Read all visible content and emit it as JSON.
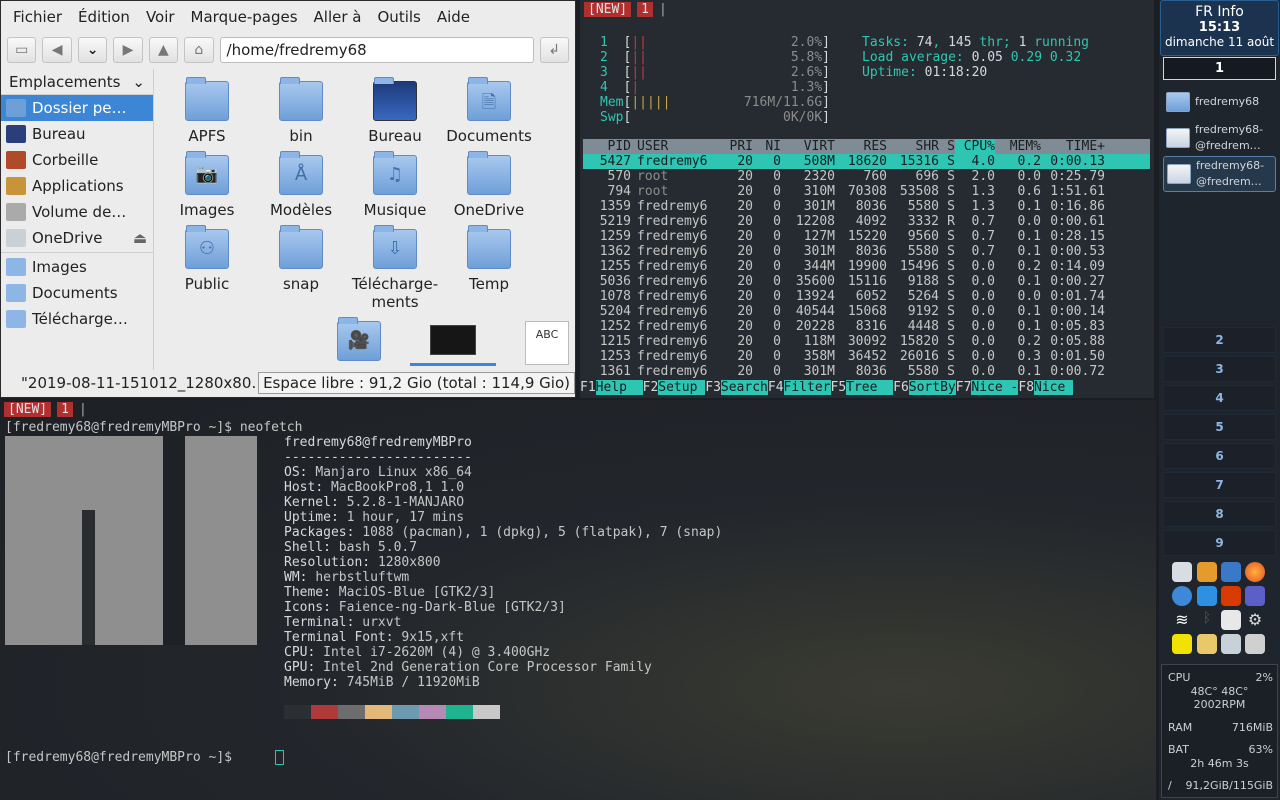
{
  "file_manager": {
    "menu": [
      "Fichier",
      "Édition",
      "Voir",
      "Marque-pages",
      "Aller à",
      "Outils",
      "Aide"
    ],
    "path": "/home/fredremy68",
    "sidebar_title": "Emplacements",
    "places": [
      "Dossier pe…",
      "Bureau",
      "Corbeille",
      "Applications",
      "Volume de…",
      "OneDrive"
    ],
    "bookmarks": [
      "Images",
      "Documents",
      "Télécharge…"
    ],
    "items": [
      {
        "label": "APFS",
        "glyph": ""
      },
      {
        "label": "bin",
        "glyph": ""
      },
      {
        "label": "Bureau",
        "glyph": ""
      },
      {
        "label": "Documents",
        "glyph": "🗎"
      },
      {
        "label": "Images",
        "glyph": "📷"
      },
      {
        "label": "Modèles",
        "glyph": "Å"
      },
      {
        "label": "Musique",
        "glyph": "♫"
      },
      {
        "label": "OneDrive",
        "glyph": ""
      },
      {
        "label": "Public",
        "glyph": "⚇"
      },
      {
        "label": "snap",
        "glyph": ""
      },
      {
        "label": "Télécharge-ments",
        "glyph": "⇩"
      },
      {
        "label": "Temp",
        "glyph": ""
      }
    ],
    "abc_label": "ABC",
    "status_file": "\"2019-08-11-151012_1280x80…",
    "status_free": "Espace libre : 91,2 Gio (total : 114,9 Gio)"
  },
  "htop": {
    "tab_new": "[NEW]",
    "tab_num": "1",
    "cpus": [
      {
        "id": "1",
        "pct": "2.0%"
      },
      {
        "id": "2",
        "pct": "5.8%"
      },
      {
        "id": "3",
        "pct": "2.6%"
      },
      {
        "id": "4",
        "pct": "1.3%"
      }
    ],
    "mem": "716M/11.6G",
    "swp": "0K/0K",
    "tasks": "74",
    "threads": "145",
    "running": "1",
    "load": [
      "0.05",
      "0.29",
      "0.32"
    ],
    "uptime": "01:18:20",
    "columns": [
      "PID",
      "USER",
      "PRI",
      "NI",
      "VIRT",
      "RES",
      "SHR",
      "S",
      "CPU%",
      "MEM%",
      "TIME+"
    ],
    "processes": [
      [
        "5427",
        "fredremy6",
        "20",
        "0",
        "508M",
        "18620",
        "15316",
        "S",
        "4.0",
        "0.2",
        "0:00.13"
      ],
      [
        "570",
        "root",
        "20",
        "0",
        "2320",
        "760",
        "696",
        "S",
        "2.0",
        "0.0",
        "0:25.79"
      ],
      [
        "794",
        "root",
        "20",
        "0",
        "310M",
        "70308",
        "53508",
        "S",
        "1.3",
        "0.6",
        "1:51.61"
      ],
      [
        "1359",
        "fredremy6",
        "20",
        "0",
        "301M",
        "8036",
        "5580",
        "S",
        "1.3",
        "0.1",
        "0:16.86"
      ],
      [
        "5219",
        "fredremy6",
        "20",
        "0",
        "12208",
        "4092",
        "3332",
        "R",
        "0.7",
        "0.0",
        "0:00.61"
      ],
      [
        "1259",
        "fredremy6",
        "20",
        "0",
        "127M",
        "15220",
        "9560",
        "S",
        "0.7",
        "0.1",
        "0:28.15"
      ],
      [
        "1362",
        "fredremy6",
        "20",
        "0",
        "301M",
        "8036",
        "5580",
        "S",
        "0.7",
        "0.1",
        "0:00.53"
      ],
      [
        "1255",
        "fredremy6",
        "20",
        "0",
        "344M",
        "19900",
        "15496",
        "S",
        "0.0",
        "0.2",
        "0:14.09"
      ],
      [
        "5036",
        "fredremy6",
        "20",
        "0",
        "35600",
        "15116",
        "9188",
        "S",
        "0.0",
        "0.1",
        "0:00.27"
      ],
      [
        "1078",
        "fredremy6",
        "20",
        "0",
        "13924",
        "6052",
        "5264",
        "S",
        "0.0",
        "0.0",
        "0:01.74"
      ],
      [
        "5204",
        "fredremy6",
        "20",
        "0",
        "40544",
        "15068",
        "9192",
        "S",
        "0.0",
        "0.1",
        "0:00.14"
      ],
      [
        "1252",
        "fredremy6",
        "20",
        "0",
        "20228",
        "8316",
        "4448",
        "S",
        "0.0",
        "0.1",
        "0:05.83"
      ],
      [
        "1215",
        "fredremy6",
        "20",
        "0",
        "118M",
        "30092",
        "15820",
        "S",
        "0.0",
        "0.2",
        "0:05.88"
      ],
      [
        "1253",
        "fredremy6",
        "20",
        "0",
        "358M",
        "36452",
        "26016",
        "S",
        "0.0",
        "0.3",
        "0:01.50"
      ],
      [
        "1361",
        "fredremy6",
        "20",
        "0",
        "301M",
        "8036",
        "5580",
        "S",
        "0.0",
        "0.1",
        "0:00.72"
      ]
    ],
    "footer": [
      {
        "key": "F1",
        "label": "Help  "
      },
      {
        "key": "F2",
        "label": "Setup "
      },
      {
        "key": "F3",
        "label": "Search"
      },
      {
        "key": "F4",
        "label": "Filter"
      },
      {
        "key": "F5",
        "label": "Tree  "
      },
      {
        "key": "F6",
        "label": "SortBy"
      },
      {
        "key": "F7",
        "label": "Nice -"
      },
      {
        "key": "F8",
        "label": "Nice "
      }
    ]
  },
  "terminal": {
    "tab_new": "[NEW]",
    "tab_num": "1",
    "prompt": "[fredremy68@fredremyMBPro ~]$ ",
    "command": "neofetch",
    "user_host": "fredremy68@fredremyMBPro",
    "separator": "------------------------",
    "info": [
      {
        "key": "OS",
        "value": "Manjaro Linux x86_64"
      },
      {
        "key": "Host",
        "value": "MacBookPro8,1 1.0"
      },
      {
        "key": "Kernel",
        "value": "5.2.8-1-MANJARO"
      },
      {
        "key": "Uptime",
        "value": "1 hour, 17 mins"
      },
      {
        "key": "Packages",
        "value": "1088 (pacman), 1 (dpkg), 5 (flatpak), 7 (snap)"
      },
      {
        "key": "Shell",
        "value": "bash 5.0.7"
      },
      {
        "key": "Resolution",
        "value": "1280x800"
      },
      {
        "key": "WM",
        "value": "herbstluftwm"
      },
      {
        "key": "Theme",
        "value": "MaciOS-Blue [GTK2/3]"
      },
      {
        "key": "Icons",
        "value": "Faience-ng-Dark-Blue [GTK2/3]"
      },
      {
        "key": "Terminal",
        "value": "urxvt"
      },
      {
        "key": "Terminal Font",
        "value": "9x15,xft"
      },
      {
        "key": "CPU",
        "value": "Intel i7-2620M (4) @ 3.400GHz"
      },
      {
        "key": "GPU",
        "value": "Intel 2nd Generation Core Processor Family"
      },
      {
        "key": "Memory",
        "value": "745MiB / 11920MiB"
      }
    ],
    "palette": [
      "#2b2f33",
      "#b03a3a",
      "#6d6d6d",
      "#e4b77a",
      "#6e9ab0",
      "#b589b3",
      "#1fb38f",
      "#c8c8c8"
    ]
  },
  "panel": {
    "title": "FR Info",
    "time": "15:13",
    "date": "dimanche 11 août",
    "active_workspace": "1",
    "windows": [
      {
        "label": "fredremy68"
      },
      {
        "label": "fredremy68-@fredrem…"
      },
      {
        "label": "fredremy68-@fredrem…"
      }
    ],
    "workspaces": [
      "2",
      "3",
      "4",
      "5",
      "6",
      "7",
      "8",
      "9"
    ],
    "sysmon": {
      "cpu_label": "CPU",
      "cpu_pct": "2%",
      "temps": "48C° 48C°",
      "rpm": "2002RPM",
      "ram_label": "RAM",
      "ram": "716MiB",
      "bat_label": "BAT",
      "bat_pct": "63%",
      "bat_time": "2h 46m 3s",
      "disk_mount": "/",
      "disk": "91,2GiB/115GiB"
    }
  }
}
